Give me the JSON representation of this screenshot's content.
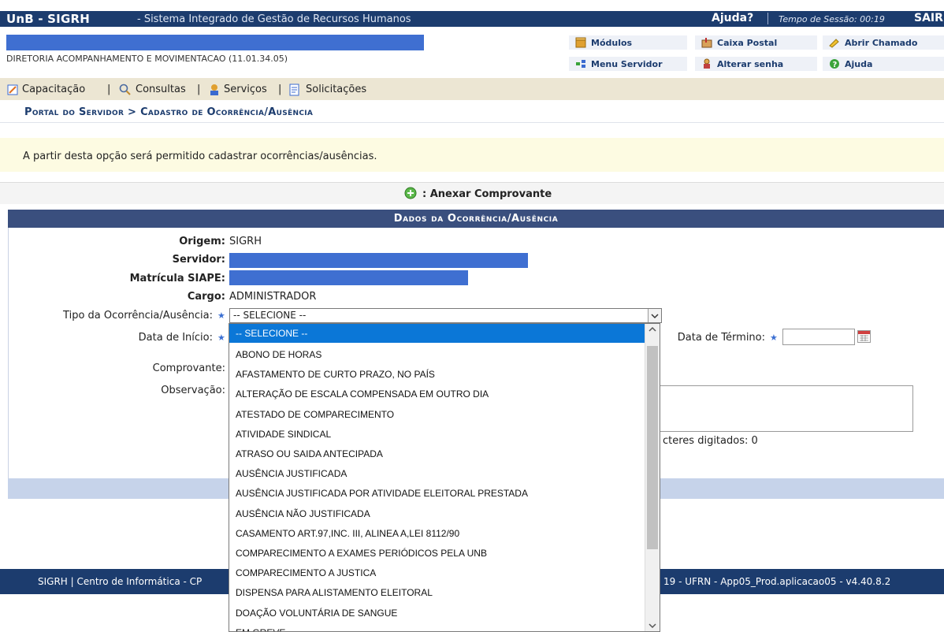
{
  "topbar": {
    "title": "UnB - SIGRH",
    "subtitle": "- Sistema Integrado de Gestão de Recursos Humanos",
    "help": "Ajuda?",
    "session": "Tempo de Sessão: 00:19",
    "exit": "SAIR"
  },
  "header": {
    "unit": "DIRETORIA ACOMPANHAMENTO E MOVIMENTACAO (11.01.34.05)",
    "menu": [
      {
        "label": "Módulos",
        "icon": "modules-icon"
      },
      {
        "label": "Caixa Postal",
        "icon": "mailbox-icon"
      },
      {
        "label": "Abrir Chamado",
        "icon": "ticket-icon"
      },
      {
        "label": "Menu Servidor",
        "icon": "server-menu-icon"
      },
      {
        "label": "Alterar senha",
        "icon": "password-icon"
      },
      {
        "label": "Ajuda",
        "icon": "help-icon"
      }
    ]
  },
  "nav": {
    "items": [
      {
        "label": "Capacitação"
      },
      {
        "label": "Consultas"
      },
      {
        "label": "Serviços"
      },
      {
        "label": "Solicitações"
      }
    ],
    "separator": "|"
  },
  "breadcrumb": "Portal do Servidor > Cadastro de Ocorrência/Ausência",
  "info": "A partir desta opção será permitido cadastrar ocorrências/ausências.",
  "legend": ": Anexar Comprovante",
  "panel": {
    "title": "Dados da Ocorrência/Ausência",
    "origem_label": "Origem:",
    "origem_value": "SIGRH",
    "servidor_label": "Servidor:",
    "matricula_label": "Matrícula SIAPE:",
    "cargo_label": "Cargo:",
    "cargo_value": "ADMINISTRADOR",
    "tipo_label": "Tipo da Ocorrência/Ausência:",
    "tipo_value": "-- SELECIONE --",
    "inicio_label": "Data de Início:",
    "termino_label": "Data de Término:",
    "comprovante_label": "Comprovante:",
    "observacao_label": "Observação:",
    "chars_text": "cteres digitados: 0",
    "required_mark": "★"
  },
  "dropdown": {
    "selected": "-- SELECIONE --",
    "options": [
      "ABONO DE HORAS",
      "AFASTAMENTO DE CURTO PRAZO, NO PAÍS",
      "ALTERAÇÃO DE ESCALA COMPENSADA EM OUTRO DIA",
      "ATESTADO DE COMPARECIMENTO",
      "ATIVIDADE SINDICAL",
      "ATRASO OU SAIDA ANTECIPADA",
      "AUSÊNCIA JUSTIFICADA",
      "AUSÊNCIA JUSTIFICADA POR ATIVIDADE ELEITORAL PRESTADA",
      "AUSÊNCIA NÃO JUSTIFICADA",
      "CASAMENTO ART.97,INC. III, ALINEA A,LEI 8112/90",
      "COMPARECIMENTO A EXAMES PERIÓDICOS PELA UNB",
      "COMPARECIMENTO A JUSTICA",
      "DISPENSA PARA ALISTAMENTO ELEITORAL",
      "DOAÇÃO VOLUNTÁRIA DE SANGUE",
      "EM GREVE"
    ]
  },
  "footer": {
    "left": "SIGRH | Centro de Informática - CP",
    "right": "19 - UFRN - App05_Prod.aplicacao05 - v4.40.8.2"
  },
  "colors": {
    "topbar": "#1c3c6e",
    "panel_header": "#3a4f7e",
    "selected_option": "#0b77d7",
    "redacted": "#3f6fd1"
  }
}
